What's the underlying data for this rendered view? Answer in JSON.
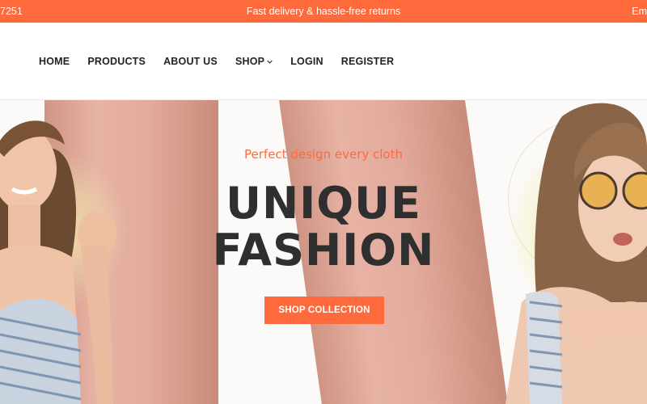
{
  "topbar": {
    "phone": "7251",
    "promo": "Fast delivery & hassle-free returns",
    "email": "Em"
  },
  "nav": {
    "items": [
      {
        "label": "HOME"
      },
      {
        "label": "PRODUCTS"
      },
      {
        "label": "ABOUT US"
      },
      {
        "label": "SHOP"
      },
      {
        "label": "LOGIN"
      },
      {
        "label": "REGISTER"
      }
    ]
  },
  "hero": {
    "tagline": "Perfect design every cloth",
    "title_line1": "UNIQUE",
    "title_line2": "FASHION",
    "cta_label": "SHOP COLLECTION"
  },
  "colors": {
    "accent": "#ff6a3d",
    "heading": "#2f2f2f"
  },
  "icons": {
    "shop_dropdown": "chevron-down-icon"
  }
}
